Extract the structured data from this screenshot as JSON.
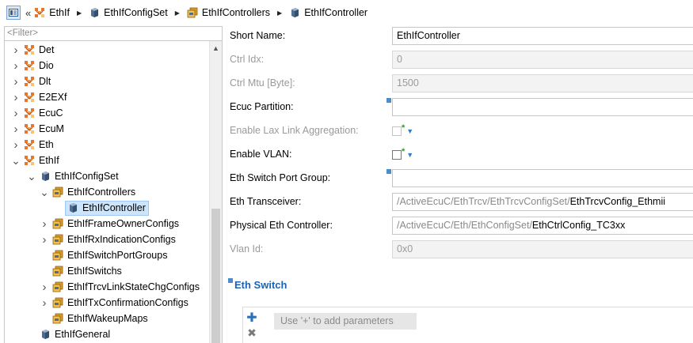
{
  "breadcrumb": {
    "items": [
      {
        "label": "EthIf",
        "icon": "module-icon"
      },
      {
        "label": "EthIfConfigSet",
        "icon": "container-icon"
      },
      {
        "label": "EthIfControllers",
        "icon": "container-list-icon"
      },
      {
        "label": "EthIfController",
        "icon": "container-icon"
      }
    ]
  },
  "filter": {
    "placeholder": "<Filter>"
  },
  "tree": {
    "items": [
      {
        "label": "Det",
        "icon": "module-icon",
        "expander": "collapsed",
        "level": 0
      },
      {
        "label": "Dio",
        "icon": "module-icon",
        "expander": "collapsed",
        "level": 0
      },
      {
        "label": "Dlt",
        "icon": "module-icon",
        "expander": "collapsed",
        "level": 0
      },
      {
        "label": "E2EXf",
        "icon": "module-icon",
        "expander": "collapsed",
        "level": 0
      },
      {
        "label": "EcuC",
        "icon": "module-icon",
        "expander": "collapsed",
        "level": 0
      },
      {
        "label": "EcuM",
        "icon": "module-icon",
        "expander": "collapsed",
        "level": 0
      },
      {
        "label": "Eth",
        "icon": "module-icon",
        "expander": "collapsed",
        "level": 0
      },
      {
        "label": "EthIf",
        "icon": "module-icon",
        "expander": "expanded",
        "level": 0
      },
      {
        "label": "EthIfConfigSet",
        "icon": "container-icon",
        "expander": "expanded",
        "level": 1
      },
      {
        "label": "EthIfControllers",
        "icon": "container-list-icon",
        "expander": "expanded",
        "level": 2
      },
      {
        "label": "EthIfController",
        "icon": "container-icon",
        "expander": "none",
        "level": 3,
        "selected": true
      },
      {
        "label": "EthIfFrameOwnerConfigs",
        "icon": "container-list-icon",
        "expander": "collapsed",
        "level": 2
      },
      {
        "label": "EthIfRxIndicationConfigs",
        "icon": "container-list-icon",
        "expander": "collapsed",
        "level": 2
      },
      {
        "label": "EthIfSwitchPortGroups",
        "icon": "container-list-icon",
        "expander": "none",
        "level": 2
      },
      {
        "label": "EthIfSwitchs",
        "icon": "container-list-icon",
        "expander": "none",
        "level": 2
      },
      {
        "label": "EthIfTrcvLinkStateChgConfigs",
        "icon": "container-list-icon",
        "expander": "collapsed",
        "level": 2
      },
      {
        "label": "EthIfTxConfirmationConfigs",
        "icon": "container-list-icon",
        "expander": "collapsed",
        "level": 2
      },
      {
        "label": "EthIfWakeupMaps",
        "icon": "container-list-icon",
        "expander": "none",
        "level": 2
      },
      {
        "label": "EthIfGeneral",
        "icon": "container-icon",
        "expander": "none",
        "level": 1
      }
    ]
  },
  "form": {
    "short_name": {
      "label": "Short Name:",
      "value": "EthIfController"
    },
    "ctrl_idx": {
      "label": "Ctrl Idx:",
      "value": "0"
    },
    "ctrl_mtu": {
      "label": "Ctrl Mtu [Byte]:",
      "value": "1500"
    },
    "ecuc_partition": {
      "label": "Ecuc Partition:",
      "value": ""
    },
    "lax_link": {
      "label": "Enable Lax Link Aggregation:",
      "checked": false
    },
    "enable_vlan": {
      "label": "Enable VLAN:",
      "checked": false
    },
    "switch_port_group": {
      "label": "Eth Switch Port Group:",
      "value": ""
    },
    "transceiver": {
      "label": "Eth Transceiver:",
      "path": "/ActiveEcuC/EthTrcv/EthTrcvConfigSet/",
      "name": "EthTrcvConfig_Ethmii"
    },
    "physical_controller": {
      "label": "Physical Eth Controller:",
      "path": "/ActiveEcuC/Eth/EthConfigSet/",
      "name": "EthCtrlConfig_TC3xx"
    },
    "vlan_id": {
      "label": "Vlan Id:",
      "value": "0x0"
    }
  },
  "eth_switch": {
    "title": "Eth Switch",
    "hint": "Use '+' to add parameters",
    "add_icon": "plus-icon",
    "delete_icon": "delete-icon"
  },
  "colors": {
    "accent": "#1d63b3",
    "selection": "#cde5fb",
    "module_icon": "#e8772e"
  }
}
